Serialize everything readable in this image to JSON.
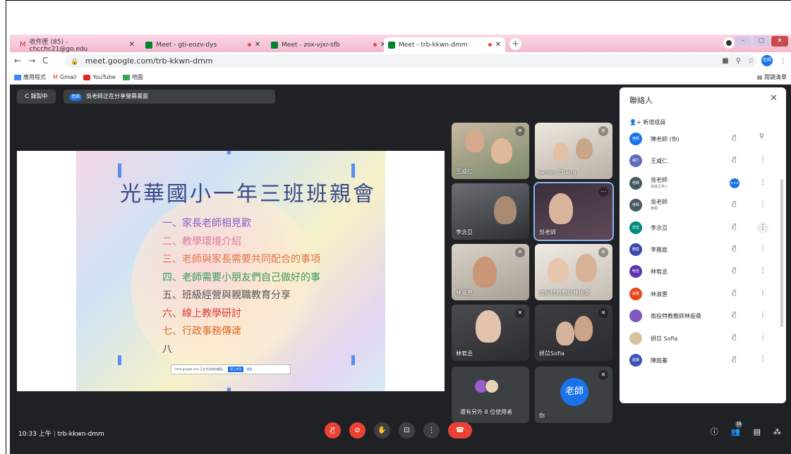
{
  "tabs": [
    {
      "label": "收件匣 (85) - chcchc21@go.edu"
    },
    {
      "label": "Meet - gti-eozv-dys"
    },
    {
      "label": "Meet - zox-vjxr-sfb"
    },
    {
      "label": "Meet - trb-kkwn-dmm"
    }
  ],
  "address": {
    "url": "meet.google.com/trb-kkwn-dmm"
  },
  "bookmarks": {
    "apps": "應用程式",
    "gmail": "Gmail",
    "youtube": "YouTube",
    "maps": "地圖",
    "reading_list": "閱讀清單"
  },
  "meet": {
    "recording_label": "錄製中",
    "sharing_tag": "老師",
    "sharing_text": "吳老師正在分享螢幕畫面",
    "slide": {
      "title": "光華國小一年三班班親會",
      "agenda": [
        {
          "text": "一、家長老師相見歡",
          "color": "#8a5cc8"
        },
        {
          "text": "二、教學環境介紹",
          "color": "#e07a9a"
        },
        {
          "text": "三、老師與家長需要共同配合的事項",
          "color": "#e0784a"
        },
        {
          "text": "四、老師需要小朋友們自己做好的事",
          "color": "#3a9a5a"
        },
        {
          "text": "五、班級經營與親職教育分享",
          "color": "#555555"
        },
        {
          "text": "六、線上教學研討",
          "color": "#e03a3a"
        },
        {
          "text": "七、行政事務傳達",
          "color": "#e06a2a"
        },
        {
          "text": "八",
          "color": "#444444"
        }
      ],
      "popup_text": "meet.google.com 正在共用你的畫面。",
      "popup_stop": "停止共用",
      "popup_hide": "隱藏"
    },
    "tiles": [
      {
        "name": "王威仁"
      },
      {
        "name": "James Chang"
      },
      {
        "name": "李念亞"
      },
      {
        "name": "吳老師"
      },
      {
        "name": "林淑惠"
      },
      {
        "name": "南投特教教師林振桑"
      },
      {
        "name": "林宥丞"
      },
      {
        "name": "妍苡Sofia"
      },
      {
        "name": "還有另外 8 位使用者"
      },
      {
        "name": "你",
        "avatar_text": "老師"
      }
    ],
    "clock": "10:33 上午",
    "meeting_code": "trb-kkwn-dmm",
    "participant_count": "18"
  },
  "people_panel": {
    "title": "聯絡人",
    "add_label": "新增成員",
    "people": [
      {
        "name": "陳老師 (你)",
        "av": "老師",
        "color": "#1a73e8"
      },
      {
        "name": "王威仁",
        "av": "威仁",
        "color": "#5c6bc0"
      },
      {
        "name": "吳老師",
        "sub": "會議主辦人",
        "av": "老師",
        "color": "#455a64"
      },
      {
        "name": "吳老師",
        "sub": "簡報",
        "av": "老師",
        "color": "#455a64"
      },
      {
        "name": "李念亞",
        "av": "念亞",
        "color": "#00897b"
      },
      {
        "name": "李雅庭",
        "av": "雅庭",
        "color": "#3949ab"
      },
      {
        "name": "林宥丞",
        "av": "宥丞",
        "color": "#5e35b1"
      },
      {
        "name": "林淑惠",
        "av": "淑惠",
        "color": "#e64a19"
      },
      {
        "name": "南投特教教師林振桑",
        "av": "",
        "color": "#7e57c2"
      },
      {
        "name": "妍苡 Sofia",
        "av": "",
        "color": "#d7c3a0"
      },
      {
        "name": "陳庭蓁",
        "av": "庭蓁",
        "color": "#3f51b5"
      }
    ]
  }
}
